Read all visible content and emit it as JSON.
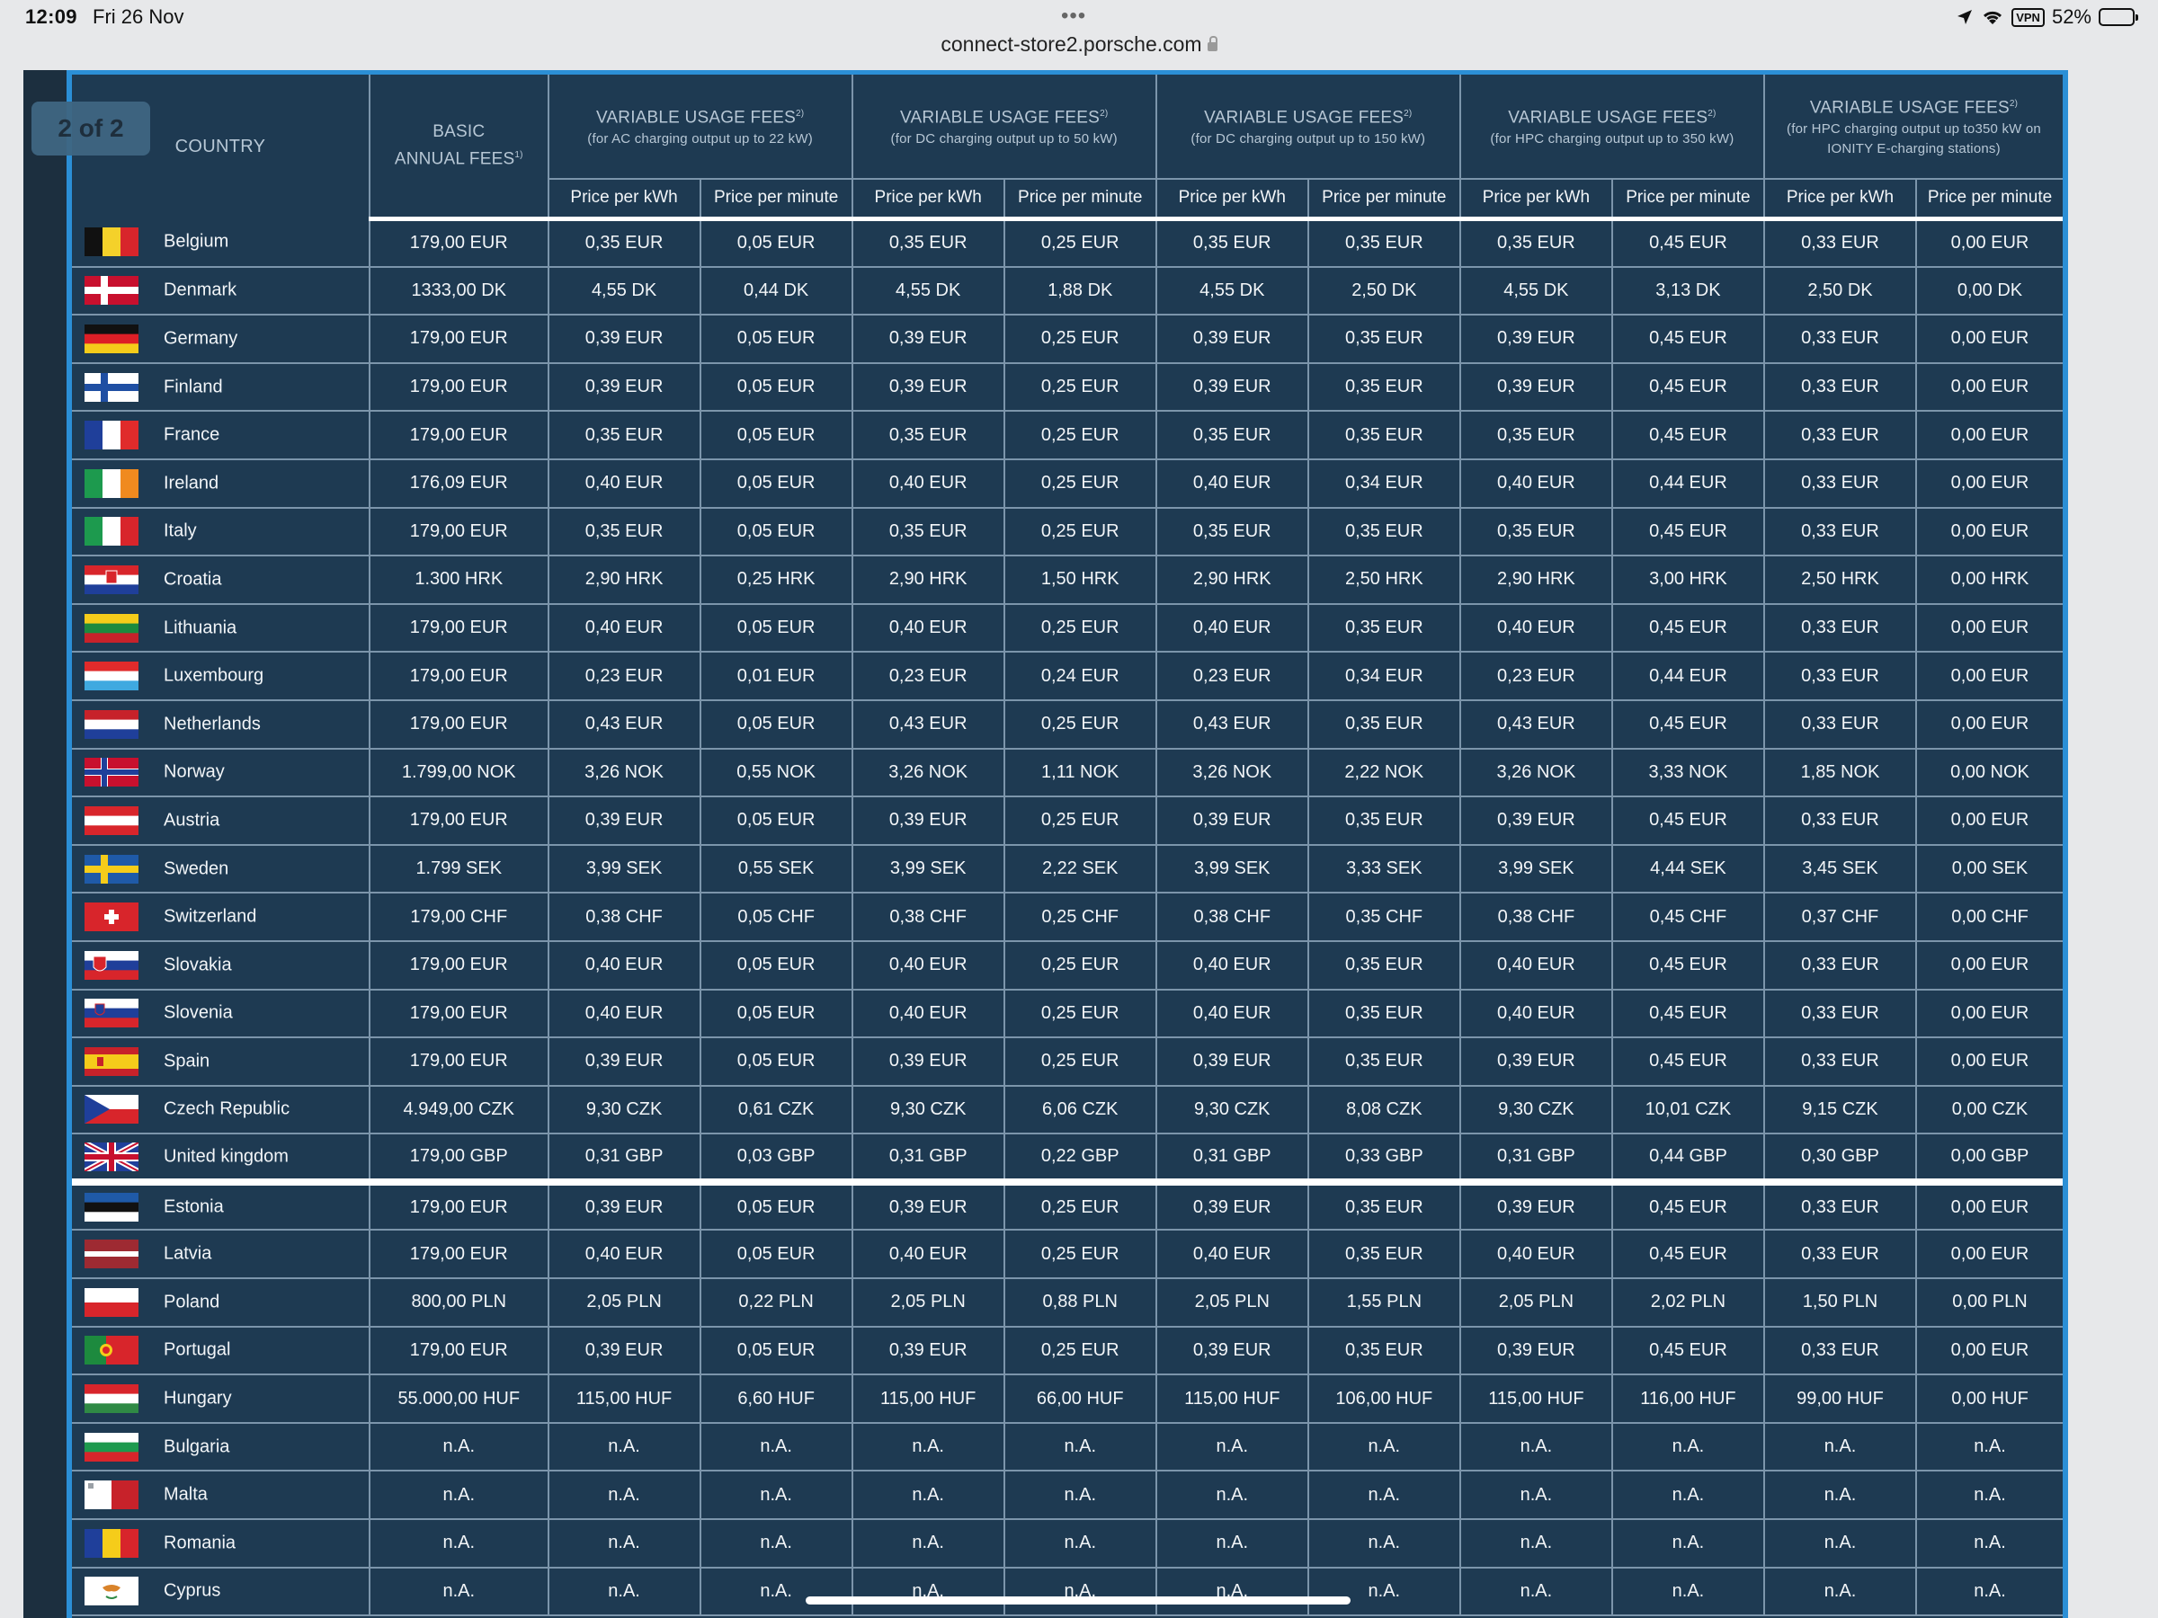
{
  "status_bar": {
    "time": "12:09",
    "date": "Fri 26 Nov",
    "battery": "52%",
    "vpn": "VPN"
  },
  "browser": {
    "url": "connect-store2.porsche.com"
  },
  "page_badge": "2 of 2",
  "table": {
    "header": {
      "country": "COUNTRY",
      "basic_line1": "BASIC",
      "basic_line2": "ANNUAL FEES",
      "basic_sup": "1)",
      "groups": [
        {
          "title": "VARIABLE USAGE FEES",
          "sup": "2)",
          "sub": "(for AC charging output up to 22 kW)"
        },
        {
          "title": "VARIABLE USAGE FEES",
          "sup": "2)",
          "sub": "(for DC charging output up to 50 kW)"
        },
        {
          "title": "VARIABLE USAGE FEES",
          "sup": "2)",
          "sub": "(for DC charging output up to 150 kW)"
        },
        {
          "title": "VARIABLE USAGE FEES",
          "sup": "2)",
          "sub": "(for HPC charging output up to 350 kW)"
        },
        {
          "title": "VARIABLE USAGE FEES",
          "sup": "2)",
          "sub": "(for HPC charging output up to350 kW on IONITY E-charging stations)"
        }
      ],
      "price_per_kwh": "Price per kWh",
      "price_per_minute": "Price per minute"
    },
    "rows": [
      {
        "country": "Belgium",
        "flag": "flag-belgium",
        "values": [
          "179,00 EUR",
          "0,35 EUR",
          "0,05 EUR",
          "0,35 EUR",
          "0,25 EUR",
          "0,35 EUR",
          "0,35 EUR",
          "0,35 EUR",
          "0,45 EUR",
          "0,33 EUR",
          "0,00 EUR"
        ]
      },
      {
        "country": "Denmark",
        "flag": "flag-denmark",
        "values": [
          "1333,00 DK",
          "4,55 DK",
          "0,44 DK",
          "4,55 DK",
          "1,88 DK",
          "4,55 DK",
          "2,50 DK",
          "4,55 DK",
          "3,13 DK",
          "2,50 DK",
          "0,00 DK"
        ]
      },
      {
        "country": "Germany",
        "flag": "flag-germany",
        "values": [
          "179,00 EUR",
          "0,39 EUR",
          "0,05 EUR",
          "0,39 EUR",
          "0,25 EUR",
          "0,39 EUR",
          "0,35 EUR",
          "0,39 EUR",
          "0,45 EUR",
          "0,33 EUR",
          "0,00 EUR"
        ]
      },
      {
        "country": "Finland",
        "flag": "flag-finland",
        "values": [
          "179,00 EUR",
          "0,39 EUR",
          "0,05 EUR",
          "0,39 EUR",
          "0,25 EUR",
          "0,39 EUR",
          "0,35 EUR",
          "0,39 EUR",
          "0,45 EUR",
          "0,33 EUR",
          "0,00 EUR"
        ]
      },
      {
        "country": "France",
        "flag": "flag-france",
        "values": [
          "179,00 EUR",
          "0,35 EUR",
          "0,05 EUR",
          "0,35 EUR",
          "0,25 EUR",
          "0,35 EUR",
          "0,35 EUR",
          "0,35 EUR",
          "0,45 EUR",
          "0,33 EUR",
          "0,00 EUR"
        ]
      },
      {
        "country": "Ireland",
        "flag": "flag-ireland",
        "values": [
          "176,09 EUR",
          "0,40 EUR",
          "0,05 EUR",
          "0,40 EUR",
          "0,25 EUR",
          "0,40 EUR",
          "0,34 EUR",
          "0,40 EUR",
          "0,44 EUR",
          "0,33 EUR",
          "0,00 EUR"
        ]
      },
      {
        "country": "Italy",
        "flag": "flag-italy",
        "values": [
          "179,00 EUR",
          "0,35 EUR",
          "0,05 EUR",
          "0,35 EUR",
          "0,25 EUR",
          "0,35 EUR",
          "0,35 EUR",
          "0,35 EUR",
          "0,45 EUR",
          "0,33 EUR",
          "0,00 EUR"
        ]
      },
      {
        "country": "Croatia",
        "flag": "flag-croatia",
        "values": [
          "1.300 HRK",
          "2,90 HRK",
          "0,25 HRK",
          "2,90 HRK",
          "1,50 HRK",
          "2,90 HRK",
          "2,50 HRK",
          "2,90 HRK",
          "3,00 HRK",
          "2,50 HRK",
          "0,00 HRK"
        ]
      },
      {
        "country": "Lithuania",
        "flag": "flag-lithuania",
        "values": [
          "179,00 EUR",
          "0,40 EUR",
          "0,05 EUR",
          "0,40 EUR",
          "0,25 EUR",
          "0,40 EUR",
          "0,35 EUR",
          "0,40 EUR",
          "0,45 EUR",
          "0,33 EUR",
          "0,00 EUR"
        ]
      },
      {
        "country": "Luxembourg",
        "flag": "flag-luxembourg",
        "values": [
          "179,00 EUR",
          "0,23 EUR",
          "0,01 EUR",
          "0,23 EUR",
          "0,24 EUR",
          "0,23 EUR",
          "0,34 EUR",
          "0,23 EUR",
          "0,44 EUR",
          "0,33 EUR",
          "0,00 EUR"
        ]
      },
      {
        "country": "Netherlands",
        "flag": "flag-netherlands",
        "values": [
          "179,00 EUR",
          "0,43 EUR",
          "0,05 EUR",
          "0,43 EUR",
          "0,25 EUR",
          "0,43 EUR",
          "0,35 EUR",
          "0,43 EUR",
          "0,45 EUR",
          "0,33 EUR",
          "0,00 EUR"
        ]
      },
      {
        "country": "Norway",
        "flag": "flag-norway",
        "values": [
          "1.799,00 NOK",
          "3,26 NOK",
          "0,55 NOK",
          "3,26 NOK",
          "1,11 NOK",
          "3,26 NOK",
          "2,22 NOK",
          "3,26 NOK",
          "3,33 NOK",
          "1,85 NOK",
          "0,00 NOK"
        ]
      },
      {
        "country": "Austria",
        "flag": "flag-austria",
        "values": [
          "179,00 EUR",
          "0,39 EUR",
          "0,05 EUR",
          "0,39 EUR",
          "0,25 EUR",
          "0,39 EUR",
          "0,35 EUR",
          "0,39 EUR",
          "0,45 EUR",
          "0,33 EUR",
          "0,00 EUR"
        ]
      },
      {
        "country": "Sweden",
        "flag": "flag-sweden",
        "values": [
          "1.799 SEK",
          "3,99 SEK",
          "0,55 SEK",
          "3,99 SEK",
          "2,22 SEK",
          "3,99 SEK",
          "3,33 SEK",
          "3,99 SEK",
          "4,44 SEK",
          "3,45 SEK",
          "0,00 SEK"
        ]
      },
      {
        "country": "Switzerland",
        "flag": "flag-switzerland",
        "values": [
          "179,00 CHF",
          "0,38 CHF",
          "0,05 CHF",
          "0,38 CHF",
          "0,25 CHF",
          "0,38 CHF",
          "0,35 CHF",
          "0,38 CHF",
          "0,45 CHF",
          "0,37 CHF",
          "0,00 CHF"
        ]
      },
      {
        "country": "Slovakia",
        "flag": "flag-slovakia",
        "values": [
          "179,00 EUR",
          "0,40 EUR",
          "0,05 EUR",
          "0,40 EUR",
          "0,25 EUR",
          "0,40 EUR",
          "0,35 EUR",
          "0,40 EUR",
          "0,45 EUR",
          "0,33 EUR",
          "0,00 EUR"
        ]
      },
      {
        "country": "Slovenia",
        "flag": "flag-slovenia",
        "values": [
          "179,00 EUR",
          "0,40 EUR",
          "0,05 EUR",
          "0,40 EUR",
          "0,25 EUR",
          "0,40 EUR",
          "0,35 EUR",
          "0,40 EUR",
          "0,45 EUR",
          "0,33 EUR",
          "0,00 EUR"
        ]
      },
      {
        "country": "Spain",
        "flag": "flag-spain",
        "values": [
          "179,00 EUR",
          "0,39 EUR",
          "0,05 EUR",
          "0,39 EUR",
          "0,25 EUR",
          "0,39 EUR",
          "0,35 EUR",
          "0,39 EUR",
          "0,45 EUR",
          "0,33 EUR",
          "0,00 EUR"
        ]
      },
      {
        "country": "Czech Republic",
        "flag": "flag-czech-republic",
        "values": [
          "4.949,00 CZK",
          "9,30 CZK",
          "0,61 CZK",
          "9,30 CZK",
          "6,06 CZK",
          "9,30 CZK",
          "8,08 CZK",
          "9,30 CZK",
          "10,01 CZK",
          "9,15 CZK",
          "0,00 CZK"
        ]
      },
      {
        "country": "United kingdom",
        "flag": "flag-united-kingdom",
        "values": [
          "179,00 GBP",
          "0,31 GBP",
          "0,03 GBP",
          "0,31 GBP",
          "0,22 GBP",
          "0,31 GBP",
          "0,33 GBP",
          "0,31 GBP",
          "0,44 GBP",
          "0,30 GBP",
          "0,00 GBP"
        ]
      },
      {
        "country": "Estonia",
        "flag": "flag-estonia",
        "values": [
          "179,00 EUR",
          "0,39 EUR",
          "0,05 EUR",
          "0,39 EUR",
          "0,25 EUR",
          "0,39 EUR",
          "0,35 EUR",
          "0,39 EUR",
          "0,45 EUR",
          "0,33 EUR",
          "0,00 EUR"
        ]
      },
      {
        "country": "Latvia",
        "flag": "flag-latvia",
        "values": [
          "179,00 EUR",
          "0,40 EUR",
          "0,05 EUR",
          "0,40 EUR",
          "0,25 EUR",
          "0,40 EUR",
          "0,35 EUR",
          "0,40 EUR",
          "0,45 EUR",
          "0,33 EUR",
          "0,00 EUR"
        ]
      },
      {
        "country": "Poland",
        "flag": "flag-poland",
        "values": [
          "800,00 PLN",
          "2,05 PLN",
          "0,22 PLN",
          "2,05 PLN",
          "0,88 PLN",
          "2,05 PLN",
          "1,55 PLN",
          "2,05 PLN",
          "2,02 PLN",
          "1,50 PLN",
          "0,00 PLN"
        ]
      },
      {
        "country": "Portugal",
        "flag": "flag-portugal",
        "values": [
          "179,00 EUR",
          "0,39 EUR",
          "0,05 EUR",
          "0,39 EUR",
          "0,25 EUR",
          "0,39 EUR",
          "0,35 EUR",
          "0,39 EUR",
          "0,45 EUR",
          "0,33 EUR",
          "0,00 EUR"
        ]
      },
      {
        "country": "Hungary",
        "flag": "flag-hungary",
        "values": [
          "55.000,00 HUF",
          "115,00 HUF",
          "6,60 HUF",
          "115,00 HUF",
          "66,00 HUF",
          "115,00 HUF",
          "106,00 HUF",
          "115,00 HUF",
          "116,00 HUF",
          "99,00 HUF",
          "0,00 HUF"
        ]
      },
      {
        "country": "Bulgaria",
        "flag": "flag-bulgaria",
        "values": [
          "n.A.",
          "n.A.",
          "n.A.",
          "n.A.",
          "n.A.",
          "n.A.",
          "n.A.",
          "n.A.",
          "n.A.",
          "n.A.",
          "n.A."
        ]
      },
      {
        "country": "Malta",
        "flag": "flag-malta",
        "values": [
          "n.A.",
          "n.A.",
          "n.A.",
          "n.A.",
          "n.A.",
          "n.A.",
          "n.A.",
          "n.A.",
          "n.A.",
          "n.A.",
          "n.A."
        ]
      },
      {
        "country": "Romania",
        "flag": "flag-romania",
        "values": [
          "n.A.",
          "n.A.",
          "n.A.",
          "n.A.",
          "n.A.",
          "n.A.",
          "n.A.",
          "n.A.",
          "n.A.",
          "n.A.",
          "n.A."
        ]
      },
      {
        "country": "Cyprus",
        "flag": "flag-cyprus",
        "values": [
          "n.A.",
          "n.A.",
          "n.A.",
          "n.A.",
          "n.A.",
          "n.A.",
          "n.A.",
          "n.A.",
          "n.A.",
          "n.A.",
          "n.A."
        ]
      }
    ],
    "separator_after_row": 19
  },
  "colors": {
    "table_background": "#1e3a52",
    "grid_lines": "#7c95ab",
    "frame_accent": "#2b8fd6",
    "cell_text": "#f2f5f8"
  }
}
